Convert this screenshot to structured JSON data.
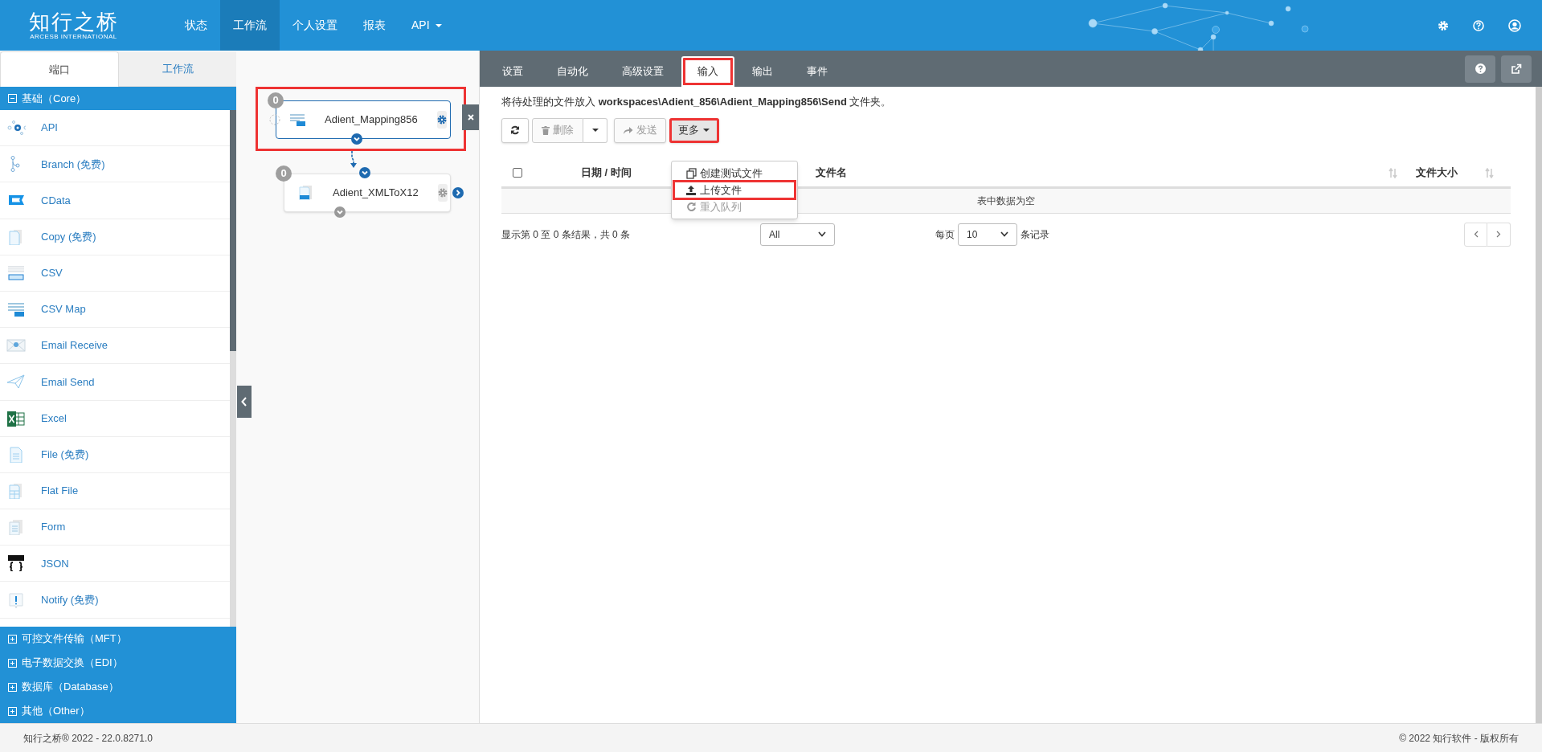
{
  "header": {
    "logo": "知行之桥",
    "logo_sub": "ARCESB INTERNATIONAL",
    "nav": [
      {
        "label": "状态",
        "selected": false,
        "dropdown": false
      },
      {
        "label": "工作流",
        "selected": true,
        "dropdown": false
      },
      {
        "label": "个人设置",
        "selected": false,
        "dropdown": false
      },
      {
        "label": "报表",
        "selected": false,
        "dropdown": false
      },
      {
        "label": "API",
        "selected": false,
        "dropdown": true
      }
    ]
  },
  "sidebar": {
    "tabs": [
      {
        "label": "端口",
        "selected": true
      },
      {
        "label": "工作流",
        "selected": false
      }
    ],
    "groups": [
      {
        "label": "基础（Core）",
        "expanded": true,
        "items": [
          {
            "label": "API",
            "kind": "api"
          },
          {
            "label": "Branch (免费)",
            "kind": "branch"
          },
          {
            "label": "CData",
            "kind": "cdata"
          },
          {
            "label": "Copy (免费)",
            "kind": "copy"
          },
          {
            "label": "CSV",
            "kind": "csv"
          },
          {
            "label": "CSV Map",
            "kind": "csvmap"
          },
          {
            "label": "Email Receive",
            "kind": "emailreceive"
          },
          {
            "label": "Email Send",
            "kind": "emailsend"
          },
          {
            "label": "Excel",
            "kind": "excel"
          },
          {
            "label": "File (免费)",
            "kind": "file"
          },
          {
            "label": "Flat File",
            "kind": "flatfile"
          },
          {
            "label": "Form",
            "kind": "form"
          },
          {
            "label": "JSON",
            "kind": "json"
          },
          {
            "label": "Notify (免费)",
            "kind": "notify"
          }
        ]
      },
      {
        "label": "可控文件传输（MFT）",
        "expanded": false
      },
      {
        "label": "电子数据交换（EDI）",
        "expanded": false
      },
      {
        "label": "数据库（Database）",
        "expanded": false
      },
      {
        "label": "其他（Other）",
        "expanded": false
      }
    ]
  },
  "canvas": {
    "nodes": [
      {
        "name": "Adient_Mapping856",
        "count": "0",
        "kind": "map",
        "selected": true,
        "highlighted": true
      },
      {
        "name": "Adient_XMLToX12",
        "count": "0",
        "kind": "xml",
        "selected": false,
        "highlighted": false
      }
    ]
  },
  "panel": {
    "tabs": [
      {
        "label": "设置",
        "selected": false,
        "highlighted": false
      },
      {
        "label": "自动化",
        "selected": false,
        "highlighted": false
      },
      {
        "label": "高级设置",
        "selected": false,
        "highlighted": false
      },
      {
        "label": "输入",
        "selected": true,
        "highlighted": true
      },
      {
        "label": "输出",
        "selected": false,
        "highlighted": false
      },
      {
        "label": "事件",
        "selected": false,
        "highlighted": false
      }
    ],
    "description": "将待处理的文件放入 **workspaces\\Adient_856\\Adient_Mapping856\\Send** 文件夹。",
    "toolbar": {
      "delete": {
        "label": "删除",
        "disabled": true
      },
      "send": {
        "label": "发送",
        "disabled": true
      },
      "more": {
        "label": "更多",
        "highlighted": true
      }
    },
    "menu": [
      {
        "label": "创建测试文件",
        "kind": "create",
        "disabled": false,
        "highlighted": false
      },
      {
        "label": "上传文件",
        "kind": "upload",
        "disabled": false,
        "highlighted": true
      },
      {
        "label": "重入队列",
        "kind": "requeue",
        "disabled": true,
        "highlighted": false
      }
    ],
    "table": {
      "select_all": false,
      "columns": [
        "日期 / 时间",
        "文件名",
        "文件大小"
      ],
      "empty": "表中数据为空"
    },
    "info": "显示第 0 至 0 条结果，共 0 条",
    "filter": "All",
    "page_size_label": "每页",
    "page_size": "10",
    "page_size_suffix": "条记录"
  },
  "footer": {
    "left": "知行之桥® 2022 - 22.0.8271.0",
    "right": "© 2022 知行软件 - 版权所有"
  }
}
